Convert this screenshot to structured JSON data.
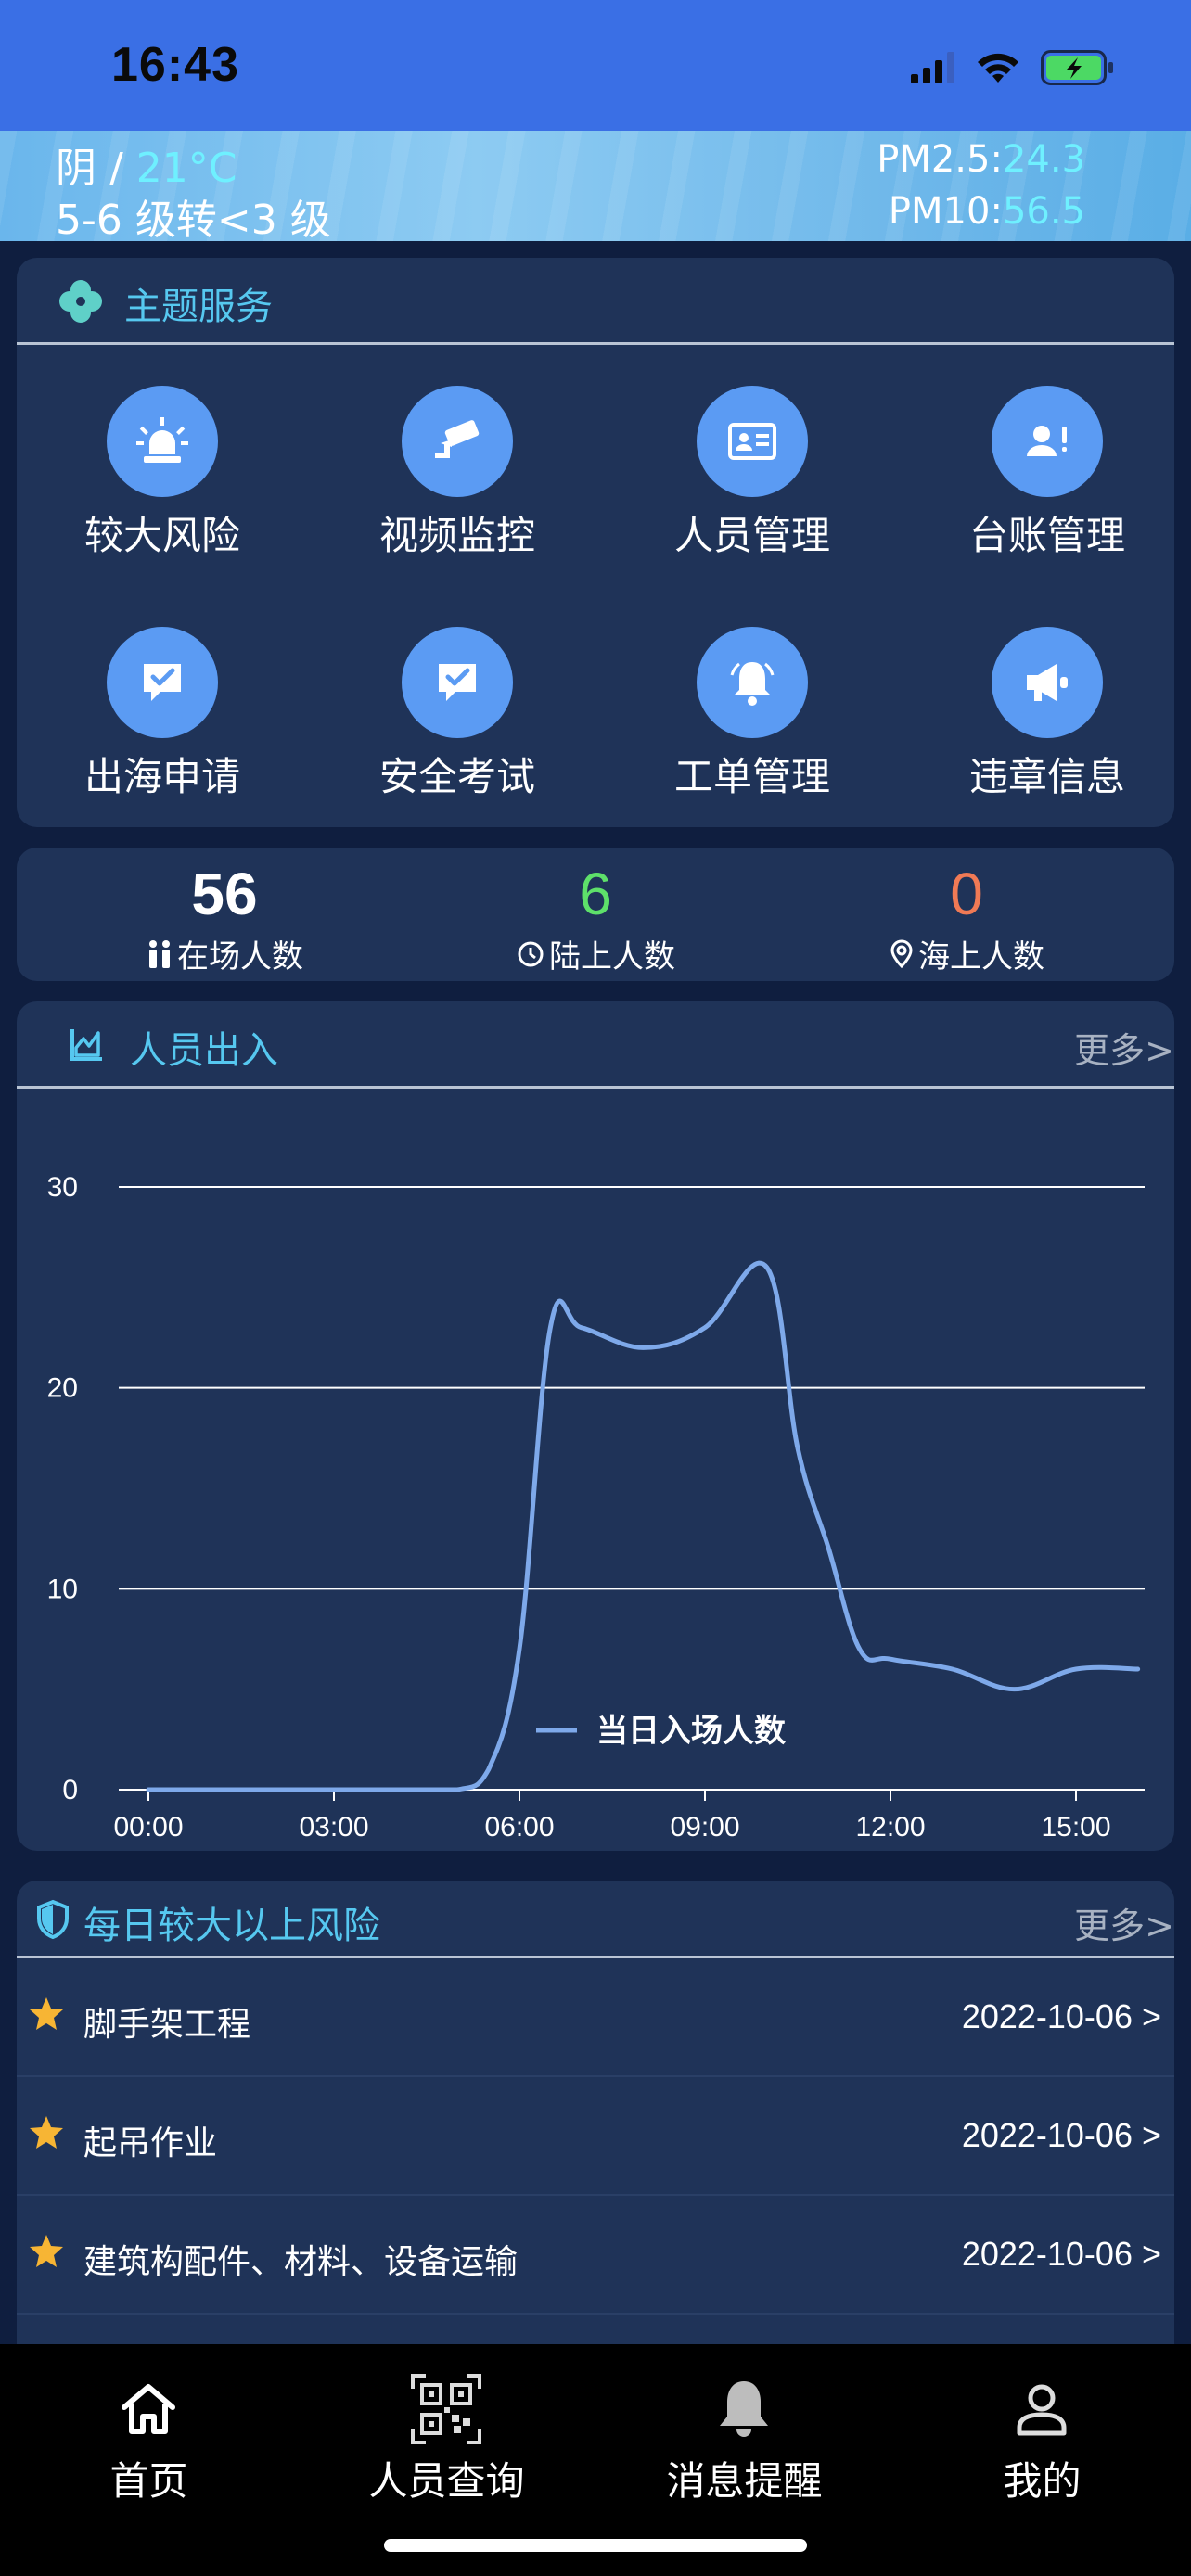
{
  "status_bar": {
    "time": "16:43"
  },
  "weather": {
    "condition": "阴 / ",
    "temperature": "21°C",
    "wind": "5-6 级转<3 级",
    "pm25_label": "PM2.5:",
    "pm25_value": "24.3",
    "pm10_label": "PM10:",
    "pm10_value": "56.5"
  },
  "services": {
    "title": "主题服务",
    "items": [
      {
        "label": "较大风险",
        "icon": "alarm-light-icon"
      },
      {
        "label": "视频监控",
        "icon": "cctv-camera-icon"
      },
      {
        "label": "人员管理",
        "icon": "id-card-icon"
      },
      {
        "label": "台账管理",
        "icon": "user-alert-icon"
      },
      {
        "label": "出海申请",
        "icon": "checked-chat-icon"
      },
      {
        "label": "安全考试",
        "icon": "checked-chat-icon"
      },
      {
        "label": "工单管理",
        "icon": "bell-icon"
      },
      {
        "label": "违章信息",
        "icon": "megaphone-icon"
      }
    ]
  },
  "stats": [
    {
      "value": "56",
      "label": "在场人数",
      "color": "#ffffff",
      "icon": "people-icon"
    },
    {
      "value": "6",
      "label": "陆上人数",
      "color": "#5ee06a",
      "icon": "clock-icon"
    },
    {
      "value": "0",
      "label": "海上人数",
      "color": "#f07a55",
      "icon": "location-pin-icon"
    }
  ],
  "traffic": {
    "title": "人员出入",
    "more": "更多>"
  },
  "chart_data": {
    "type": "line",
    "title": "",
    "xlabel": "",
    "ylabel": "",
    "x_ticks": [
      "00:00",
      "03:00",
      "06:00",
      "09:00",
      "12:00",
      "15:00"
    ],
    "y_ticks": [
      "0",
      "10",
      "20",
      "30"
    ],
    "ylim": [
      0,
      30
    ],
    "xlim_hours": [
      0,
      16
    ],
    "grid": true,
    "legend_position": "bottom",
    "series": [
      {
        "name": "当日入场人数",
        "color": "#7ea9ea",
        "x_hours": [
          0,
          1,
          2,
          3,
          4,
          5,
          5.5,
          6,
          6.5,
          7,
          8,
          9,
          10,
          10.5,
          11,
          11.5,
          12,
          13,
          14,
          15,
          16
        ],
        "values": [
          0,
          0,
          0,
          0,
          0,
          0,
          1,
          7,
          23,
          23,
          22,
          23,
          26,
          17,
          12,
          7,
          6.5,
          6,
          5,
          6,
          6
        ]
      }
    ]
  },
  "risks": {
    "title": "每日较大以上风险",
    "more": "更多>",
    "items": [
      {
        "title": "脚手架工程",
        "date": "2022-10-06 >"
      },
      {
        "title": "起吊作业",
        "date": "2022-10-06 >"
      },
      {
        "title": "建筑构配件、材料、设备运输",
        "date": "2022-10-06 >"
      }
    ]
  },
  "tabs": [
    {
      "label": "首页",
      "icon": "home-icon"
    },
    {
      "label": "人员查询",
      "icon": "qr-code-icon"
    },
    {
      "label": "消息提醒",
      "icon": "bell-icon"
    },
    {
      "label": "我的",
      "icon": "user-icon"
    }
  ]
}
